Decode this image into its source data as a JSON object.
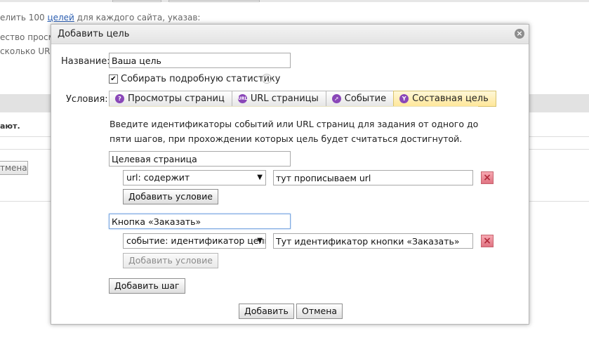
{
  "background": {
    "line1_prefix": "елить 100 ",
    "line1_link": "целей",
    "line1_suffix": " для каждого сайта, указав:",
    "line2": "ество просм",
    "line3": "сколько URL",
    "bold_text": "ают.",
    "button_label": "тмена"
  },
  "dialog": {
    "title": "Добавить цель",
    "name_label": "Название:",
    "name_value": "Ваша цель",
    "stats_checkbox_label": "Собирать подробную статистику",
    "stats_checked": true,
    "conditions_label": "Условия:",
    "tabs": [
      {
        "label": "Просмотры страниц",
        "icon": "page-views-icon",
        "glyph": "?"
      },
      {
        "label": "URL страницы",
        "icon": "url-icon",
        "glyph": "URL"
      },
      {
        "label": "Событие",
        "icon": "cursor-icon",
        "glyph": "➚"
      },
      {
        "label": "Составная цель",
        "icon": "composite-icon",
        "glyph": "Y",
        "active": true
      }
    ],
    "description": "Введите идентификаторы событий или URL страниц для задания от одного до пяти шагов, при прохождении которых цель будет считаться достигнутой.",
    "steps": [
      {
        "name": "Целевая страница",
        "condition_type": "url: содержит",
        "condition_value": "тут прописываем url",
        "add_condition_label": "Добавить условие"
      },
      {
        "name": "Кнопка «Заказать»",
        "condition_type": "событие: идентификатор цели",
        "condition_value": "Тут идентификатор кнопки «Заказать»",
        "add_condition_label": "Добавить условие"
      }
    ],
    "add_step_label": "Добавить шаг",
    "submit_label": "Добавить",
    "cancel_label": "Отмена"
  },
  "colors": {
    "active_tab": "#ffe79a",
    "tab_icon": "#8a47b8",
    "delete_icon": "#e07382",
    "link": "#2a5db0"
  }
}
